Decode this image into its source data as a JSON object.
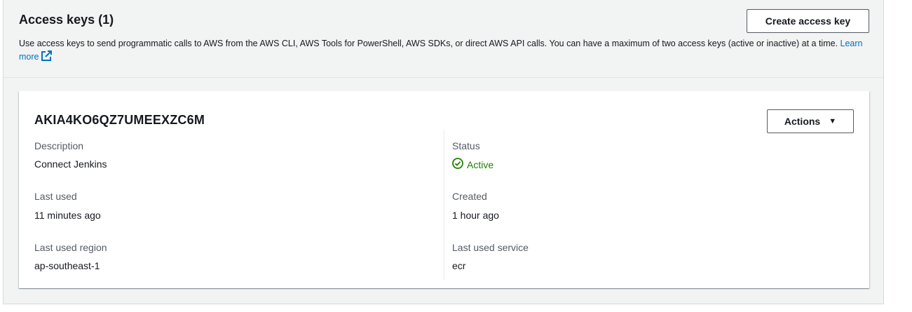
{
  "header": {
    "title": "Access keys (1)",
    "description": "Use access keys to send programmatic calls to AWS from the AWS CLI, AWS Tools for PowerShell, AWS SDKs, or direct AWS API calls. You can have a maximum of two access keys (active or inactive) at a time.",
    "learn_more": "Learn more",
    "create_button": "Create access key"
  },
  "key": {
    "id": "AKIA4KO6QZ7UMEEXZC6M",
    "actions_label": "Actions",
    "fields": {
      "description_label": "Description",
      "description_value": "Connect Jenkins",
      "status_label": "Status",
      "status_value": "Active",
      "last_used_label": "Last used",
      "last_used_value": "11 minutes ago",
      "created_label": "Created",
      "created_value": "1 hour ago",
      "last_used_region_label": "Last used region",
      "last_used_region_value": "ap-southeast-1",
      "last_used_service_label": "Last used service",
      "last_used_service_value": "ecr"
    }
  },
  "colors": {
    "status_active": "#1d8102",
    "link": "#0073bb"
  },
  "icons": {
    "external_link": "external-link-icon",
    "status": "status-check-icon",
    "caret": "caret-down-icon"
  }
}
